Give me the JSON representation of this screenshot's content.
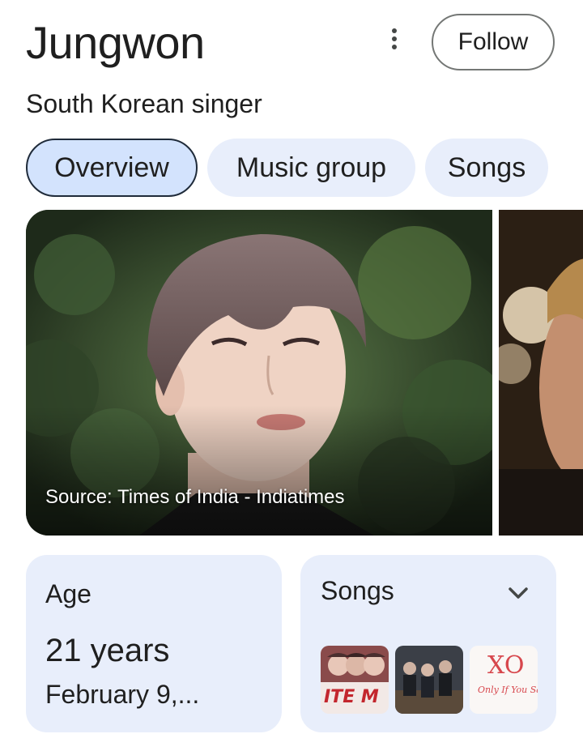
{
  "header": {
    "title": "Jungwon",
    "subtitle": "South Korean singer",
    "follow_label": "Follow"
  },
  "tabs": [
    {
      "label": "Overview",
      "active": true
    },
    {
      "label": "Music group",
      "active": false
    },
    {
      "label": "Songs",
      "active": false
    }
  ],
  "photos": {
    "source_caption": "Source: Times of India - Indiatimes"
  },
  "age_card": {
    "label": "Age",
    "value": "21 years",
    "date": "February 9,..."
  },
  "songs_card": {
    "label": "Songs",
    "thumbnails": [
      {
        "text": "ITE M"
      },
      {
        "text": ""
      },
      {
        "text": "XO",
        "subtext": "Only If You Say Yes"
      }
    ]
  },
  "icons": {
    "more": "more-vertical-icon",
    "expand": "chevron-down-icon"
  },
  "colors": {
    "chip_bg": "#e8eefb",
    "chip_active_bg": "#d3e3fd",
    "text": "#1f1f1f"
  }
}
